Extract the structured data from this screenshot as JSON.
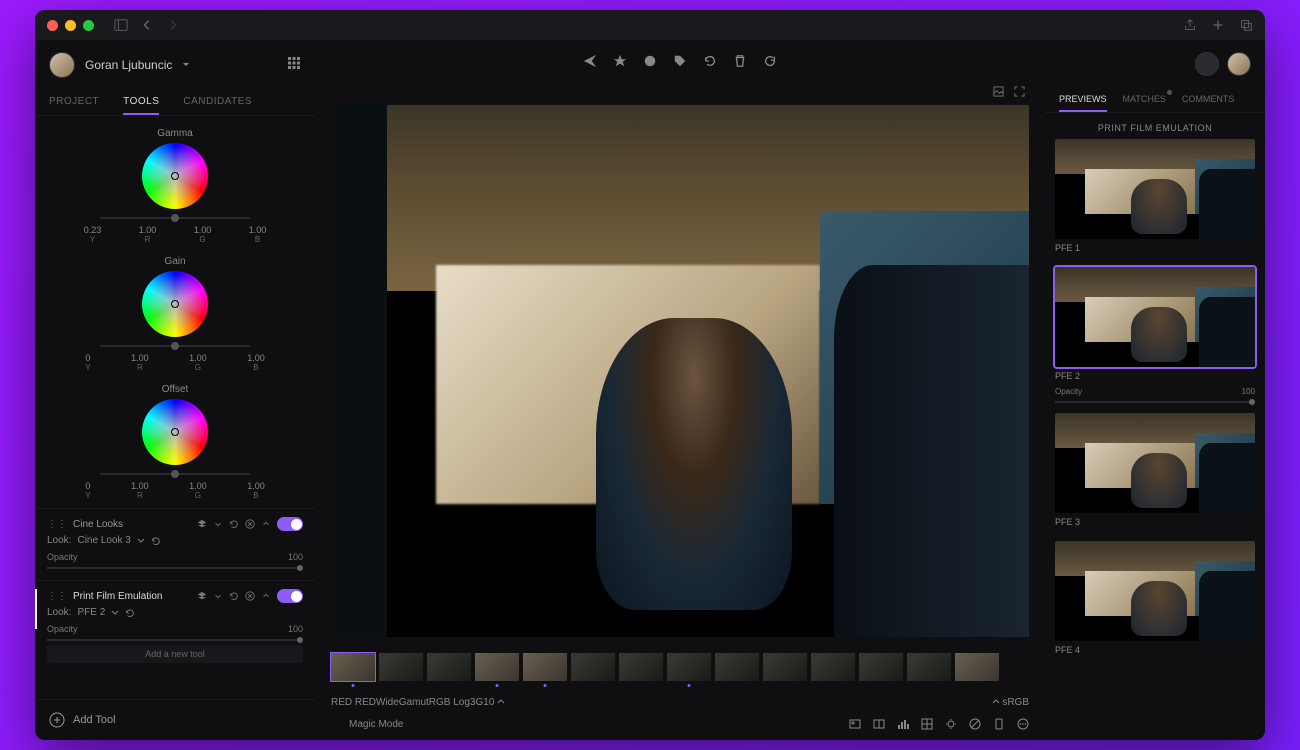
{
  "user": {
    "name": "Goran Ljubuncic"
  },
  "left_tabs": {
    "project": "PROJECT",
    "tools": "TOOLS",
    "candidates": "CANDIDATES"
  },
  "wheels": {
    "gamma": {
      "label": "Gamma",
      "y": "0.23",
      "r": "1.00",
      "g": "1.00",
      "b": "1.00",
      "y_lab": "Y",
      "r_lab": "R",
      "g_lab": "G",
      "b_lab": "B"
    },
    "gain": {
      "label": "Gain",
      "y": "0",
      "r": "1.00",
      "g": "1.00",
      "b": "1.00",
      "y_lab": "Y",
      "r_lab": "R",
      "g_lab": "G",
      "b_lab": "B"
    },
    "offset": {
      "label": "Offset",
      "y": "0",
      "r": "1.00",
      "g": "1.00",
      "b": "1.00",
      "y_lab": "Y",
      "r_lab": "R",
      "g_lab": "G",
      "b_lab": "B"
    }
  },
  "tools": {
    "cine": {
      "name": "Cine Looks",
      "look_label": "Look:",
      "look_name": "Cine Look 3",
      "opacity_label": "Opacity",
      "opacity_value": "100"
    },
    "pfe": {
      "name": "Print Film Emulation",
      "look_label": "Look:",
      "look_name": "PFE 2",
      "opacity_label": "Opacity",
      "opacity_value": "100"
    },
    "add_new": "Add a new tool",
    "add_tool": "Add Tool"
  },
  "footer": {
    "colorspace": "RED REDWideGamutRGB Log3G10",
    "output": "sRGB",
    "magic": "Magic Mode"
  },
  "right_tabs": {
    "previews": "PREVIEWS",
    "matches": "MATCHES",
    "comments": "COMMENTS"
  },
  "presets": {
    "header": "PRINT FILM EMULATION",
    "items": [
      {
        "label": "PFE 1"
      },
      {
        "label": "PFE 2",
        "opacity_label": "Opacity",
        "opacity_value": "100"
      },
      {
        "label": "PFE 3"
      },
      {
        "label": "PFE 4"
      }
    ]
  }
}
